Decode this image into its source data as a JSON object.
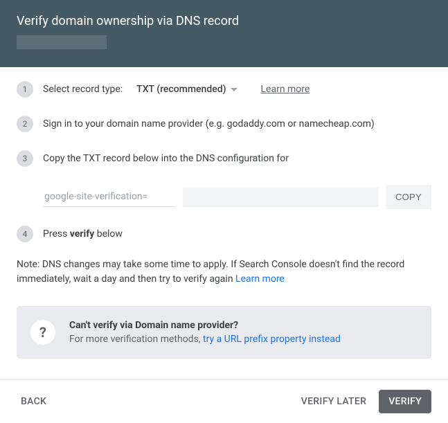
{
  "header": {
    "title": "Verify domain ownership via DNS record"
  },
  "steps": {
    "one": {
      "num": "1",
      "label": "Select record type:",
      "select_value": "TXT (recommended)",
      "learn": "Learn more"
    },
    "two": {
      "num": "2",
      "text": "Sign in to your domain name provider (e.g. godaddy.com or namecheap.com)"
    },
    "three": {
      "num": "3",
      "text": "Copy the TXT record below into the DNS configuration for"
    },
    "four": {
      "num": "4",
      "text_pre": "Press ",
      "text_bold": "verify",
      "text_post": " below"
    }
  },
  "txt": {
    "prefix": "google-site-verification=",
    "copy": "COPY"
  },
  "note": {
    "text": "Note: DNS changes may take some time to apply. If Search Console doesn't find the record immediately, wait a day and then try to verify again ",
    "link": "Learn more"
  },
  "info": {
    "title": "Can't verify via Domain name provider?",
    "text": "For more verification methods, ",
    "link": "try a URL prefix property instead"
  },
  "footer": {
    "back": "BACK",
    "later": "VERIFY LATER",
    "verify": "VERIFY"
  }
}
